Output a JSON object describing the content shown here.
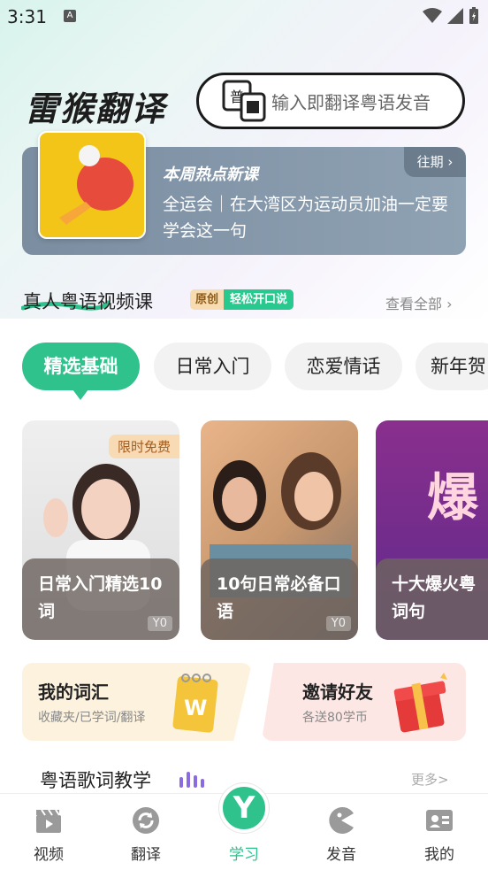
{
  "status_bar": {
    "time": "3:31",
    "app_icon_letter": "A"
  },
  "header": {
    "brand": "雷猴翻译",
    "search_placeholder": "输入即翻译粤语发音",
    "search_icon_text": "普"
  },
  "banner": {
    "title": "本周热点新课",
    "description": "全运会｜在大湾区为运动员加油一定要学会这一句",
    "past_label": "往期 ›"
  },
  "video_section": {
    "title": "真人粤语视频课",
    "tag_original": "原创",
    "tag_easy": "轻松开口说",
    "view_all": "查看全部 ›",
    "categories": [
      {
        "label": "精选基础",
        "active": true
      },
      {
        "label": "日常入门",
        "active": false
      },
      {
        "label": "恋爱情话",
        "active": false
      },
      {
        "label": "新年贺",
        "active": false
      }
    ],
    "cards": [
      {
        "title": "日常入门精选10词",
        "price": "Y0",
        "badge": "限时免费"
      },
      {
        "title": "10句日常必备口语",
        "price": "Y0"
      },
      {
        "title": "十大爆火粤词句",
        "overlay_text": "爆"
      }
    ]
  },
  "vocab_card": {
    "title": "我的词汇",
    "subtitle": "收藏夹/已学词/翻译",
    "icon_letter": "W"
  },
  "invite_card": {
    "title": "邀请好友",
    "subtitle": "各送80学币"
  },
  "lyrics_section": {
    "title": "粤语歌词教学",
    "more": "更多>"
  },
  "tabbar": {
    "tabs": [
      {
        "label": "视频",
        "icon": "clapperboard-icon"
      },
      {
        "label": "翻译",
        "icon": "refresh-icon"
      },
      {
        "label": "学习",
        "icon": "y-logo-icon",
        "active": true
      },
      {
        "label": "发音",
        "icon": "pacman-icon"
      },
      {
        "label": "我的",
        "icon": "id-card-icon"
      }
    ],
    "center_letter": "Y"
  },
  "colors": {
    "accent": "#2fc28d",
    "banner": "#8a9cad",
    "text": "#222222"
  }
}
